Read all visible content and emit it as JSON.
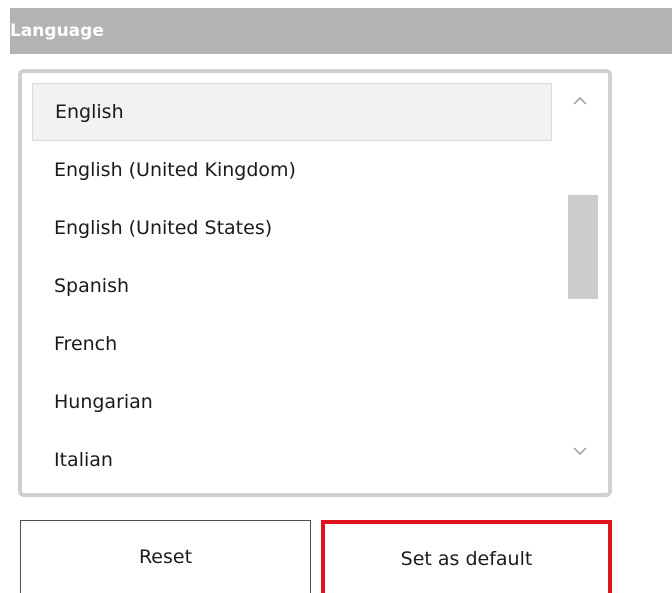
{
  "header": {
    "title": "Language"
  },
  "language_list": {
    "items": [
      {
        "label": "English",
        "selected": true
      },
      {
        "label": "English (United Kingdom)",
        "selected": false
      },
      {
        "label": "English (United States)",
        "selected": false
      },
      {
        "label": "Spanish",
        "selected": false
      },
      {
        "label": "French",
        "selected": false
      },
      {
        "label": "Hungarian",
        "selected": false
      },
      {
        "label": "Italian",
        "selected": false
      }
    ],
    "scroll": {
      "up_icon": "chevron-up",
      "down_icon": "chevron-down",
      "position_fraction": 0.36,
      "visible_fraction": 0.33
    }
  },
  "buttons": {
    "reset_label": "Reset",
    "set_default_label": "Set as default"
  },
  "colors": {
    "header_bg": "#b3b3b3",
    "highlight_border": "#e0131f"
  }
}
